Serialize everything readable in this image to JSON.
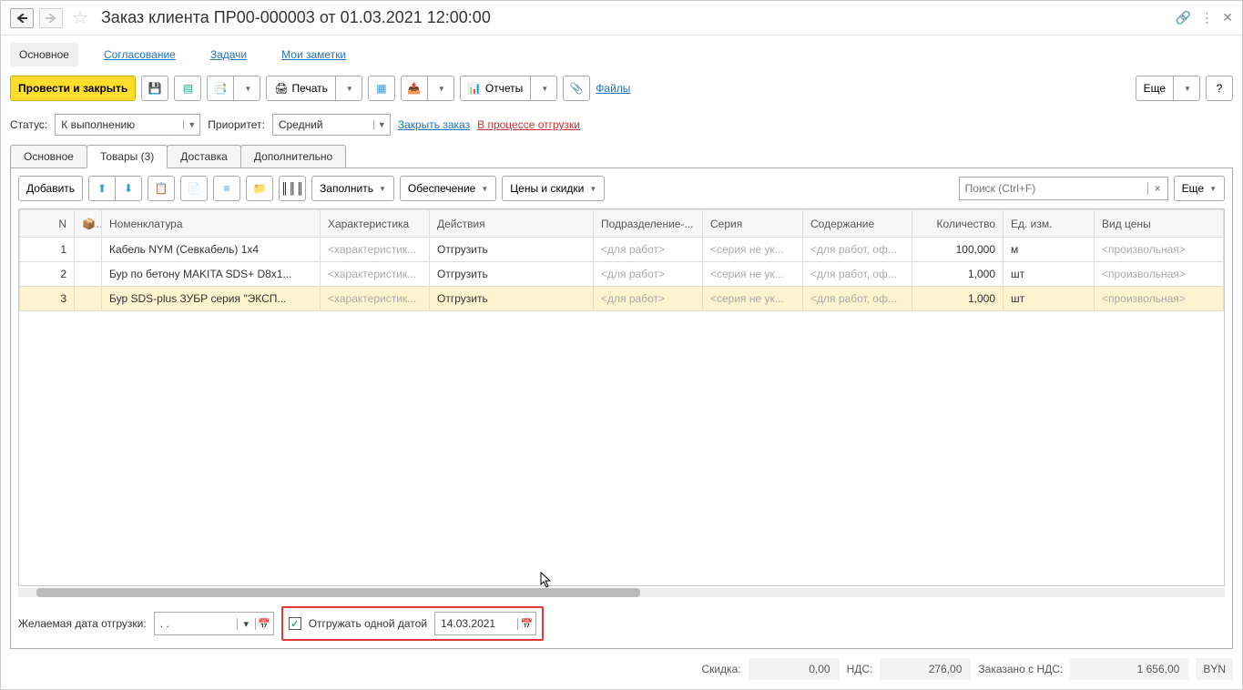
{
  "title": "Заказ клиента ПР00-000003 от 01.03.2021 12:00:00",
  "top_tabs": {
    "main": "Основное",
    "approval": "Согласование",
    "tasks": "Задачи",
    "notes": "Мои заметки"
  },
  "toolbar": {
    "post_close": "Провести и закрыть",
    "print": "Печать",
    "reports": "Отчеты",
    "files": "Файлы",
    "more": "Еще"
  },
  "status_label": "Статус:",
  "status_value": "К выполнению",
  "priority_label": "Приоритет:",
  "priority_value": "Средний",
  "close_order": "Закрыть заказ",
  "in_shipping": "В процессе отгрузки",
  "sub_tabs": {
    "main": "Основное",
    "goods": "Товары (3)",
    "delivery": "Доставка",
    "extra": "Дополнительно"
  },
  "grid_toolbar": {
    "add": "Добавить",
    "fill": "Заполнить",
    "provision": "Обеспечение",
    "prices": "Цены и скидки",
    "search_placeholder": "Поиск (Ctrl+F)",
    "more": "Еще"
  },
  "columns": {
    "n": "N",
    "item": "Номенклатура",
    "char": "Характеристика",
    "actions": "Действия",
    "dept": "Подразделение-...",
    "series": "Серия",
    "content": "Содержание",
    "qty": "Количество",
    "unit": "Ед. изм.",
    "price_type": "Вид цены"
  },
  "rows": [
    {
      "n": "1",
      "item": "Кабель NYM (Севкабель) 1х4",
      "char": "<характеристик...",
      "action": "Отгрузить",
      "dept": "<для работ>",
      "series": "<серия не ук...",
      "content": "<для работ, оф...",
      "qty": "100,000",
      "unit": "м",
      "ptype": "<произвольная>"
    },
    {
      "n": "2",
      "item": "Бур по бетону MAKITA SDS+ D8x1...",
      "char": "<характеристик...",
      "action": "Отгрузить",
      "dept": "<для работ>",
      "series": "<серия не ук...",
      "content": "<для работ, оф...",
      "qty": "1,000",
      "unit": "шт",
      "ptype": "<произвольная>"
    },
    {
      "n": "3",
      "item": "Бур SDS-plus ЗУБР серия \"ЭКСП...",
      "char": "<характеристик...",
      "action": "Отгрузить",
      "dept": "<для работ>",
      "series": "<серия не ук...",
      "content": "<для работ, оф...",
      "qty": "1,000",
      "unit": "шт",
      "ptype": "<произвольная>"
    }
  ],
  "ship": {
    "desired_label": "Желаемая дата отгрузки:",
    "desired_value": ".  .",
    "one_date_label": "Отгружать одной датой",
    "one_date_value": "14.03.2021"
  },
  "totals": {
    "discount_label": "Скидка:",
    "discount": "0,00",
    "vat_label": "НДС:",
    "vat": "276,00",
    "total_label": "Заказано с НДС:",
    "total": "1 656,00",
    "currency": "BYN"
  }
}
